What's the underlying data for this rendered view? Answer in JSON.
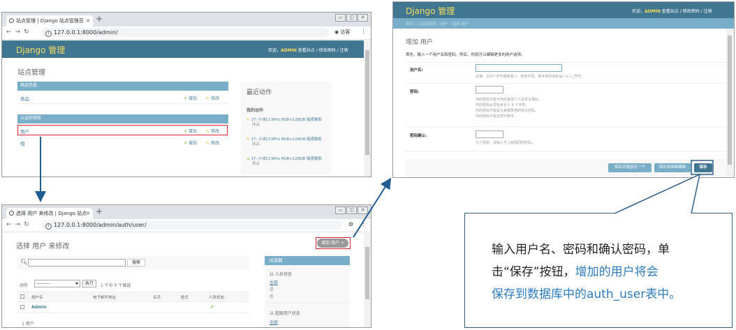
{
  "window1": {
    "tab_title": "站点管理 | Django 站点管理员",
    "url": "127.0.0.1:8000/admin/",
    "guest_label": "访客",
    "brand": "Django 管理",
    "user_tools": {
      "welcome": "欢迎，",
      "user": "ADMIN",
      "rest": " 查看站点 / 修改密码 / 注销"
    },
    "page_title": "站点管理",
    "modules": [
      {
        "caption": "商品信息",
        "rows": [
          {
            "label": "商品",
            "add": "增加",
            "change": "修改"
          }
        ]
      },
      {
        "caption": "认证和授权",
        "rows": [
          {
            "label": "用户",
            "add": "增加",
            "change": "修改"
          },
          {
            "label": "组",
            "add": "增加",
            "change": "修改"
          }
        ]
      }
    ],
    "recent": {
      "title": "最近动作",
      "subtitle": "我的动作",
      "items": [
        {
          "text": "17: 小米CC9Pro 8GB+128GB 暗夜魅影",
          "type": "商品"
        },
        {
          "text": "17: 小米CC9Pro 8GB+128GB 暗夜魅影",
          "type": "商品"
        },
        {
          "text": "17: 小米CC9Pro 8GB+128GB 暗夜魅影",
          "type": "商品"
        }
      ]
    }
  },
  "window2": {
    "tab_title": "选择 用户 来修改 | Django 站点",
    "url": "127.0.0.1:8000/admin/auth/user/",
    "page_title": "选择 用户 来修改",
    "add_button": "增加 用户 +",
    "search_button": "搜索",
    "action_label": "动作",
    "action_select": "---------",
    "execute_button": "执行",
    "selected_text": "1 个中 0 个被选",
    "columns": [
      "用户名",
      "电子邮件地址",
      "名字",
      "姓氏",
      "人员状态"
    ],
    "rows": [
      {
        "username": "Admin",
        "email": "",
        "first": "",
        "last": "",
        "staff": "✔"
      }
    ],
    "count": "1 用户",
    "filter": {
      "title": "过滤器",
      "groups": [
        {
          "heading": "以 人员状态",
          "options": [
            "全部",
            "是",
            "否"
          ]
        },
        {
          "heading": "以 超级用户状态",
          "options": [
            "全部"
          ]
        }
      ]
    }
  },
  "window3": {
    "brand": "Django 管理",
    "user_tools": {
      "welcome": "欢迎，",
      "user": "ADMIN",
      "rest": " 查看站点 / 修改密码 / 注销"
    },
    "breadcrumb": "首页 › 认证和授权 › 用户 › 增加 用户",
    "page_title": "增加 用户",
    "intro": "首先，输入一个用户名和密码。然后，你就可以编辑更多的用户选项。",
    "fields": [
      {
        "label": "用户名:",
        "help": [
          "必填。150个字符或者更少。包含字母，数字和仅有的@/./+/-/_符号。"
        ]
      },
      {
        "label": "密码:",
        "help": [
          "你的密码不能与你的其他个人信息太相似。",
          "你的密码必须包含至少 8 个字符。",
          "你的密码不能是大家都爱用的常见密码。",
          "你的密码不能全部为数字。"
        ]
      },
      {
        "label": "密码确认:",
        "help": [
          "为了校验，请输入与上面相同的密码。"
        ]
      }
    ],
    "buttons": [
      "保存并增加另一个",
      "保存并继续编辑",
      "保存"
    ]
  },
  "callout": {
    "line1": "输入用户名、密码和确认密码，单",
    "line2a": "击“保存”按钮，",
    "line2b": "增加的用户将会",
    "line3a": "保存到数据库中的auth_user",
    "line3b": "表中。"
  },
  "colors": {
    "django_header": "#417690",
    "module_caption": "#79aec8",
    "brand_yellow": "#f5dd5d",
    "highlight_red": "#d9272e",
    "arrow_blue": "#1f5c8f"
  }
}
